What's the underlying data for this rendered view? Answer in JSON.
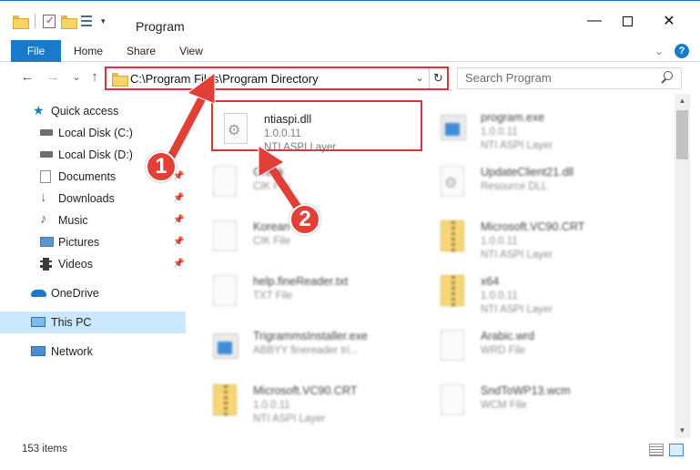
{
  "window": {
    "title": "Program",
    "minimize": "—",
    "close": "✕"
  },
  "ribbon": {
    "tabs": [
      "File",
      "Home",
      "Share",
      "View"
    ],
    "expand": "⌄",
    "help": "?"
  },
  "nav": {
    "back": "←",
    "forward": "→",
    "recent": "⌄",
    "up": "↑"
  },
  "address": {
    "path": "C:\\Program Files\\Program Directory",
    "dropdown": "⌄",
    "refresh": "↻"
  },
  "search": {
    "placeholder": "Search Program"
  },
  "sidebar": {
    "items": [
      {
        "label": "Quick access",
        "icon": "star-icon"
      },
      {
        "label": "Local Disk (C:)",
        "icon": "drive-icon"
      },
      {
        "label": "Local Disk (D:)",
        "icon": "drive-icon"
      },
      {
        "label": "Documents",
        "icon": "documents-icon"
      },
      {
        "label": "Downloads",
        "icon": "download-icon"
      },
      {
        "label": "Music",
        "icon": "music-icon"
      },
      {
        "label": "Pictures",
        "icon": "pictures-icon"
      },
      {
        "label": "Videos",
        "icon": "videos-icon"
      },
      {
        "label": "OneDrive",
        "icon": "cloud-icon"
      },
      {
        "label": "This PC",
        "icon": "computer-icon"
      },
      {
        "label": "Network",
        "icon": "network-icon"
      }
    ],
    "pin": "📌"
  },
  "files": [
    {
      "name": "ntiaspi.dll",
      "version": "1.0.0.11",
      "type": "NTI ASPI Layer",
      "icon": "dll-gear-icon"
    },
    {
      "name": "program.exe",
      "version": "1.0.0.11",
      "type": "NTI ASPI Layer",
      "icon": "exe-icon"
    },
    {
      "name": "Greek",
      "version": "",
      "type": "CIK File",
      "icon": "document-icon"
    },
    {
      "name": "UpdateClient21.dll",
      "version": "",
      "type": "Resource DLL",
      "icon": "dll-gear-icon"
    },
    {
      "name": "Korean",
      "version": "",
      "type": "CIK File",
      "icon": "document-icon"
    },
    {
      "name": "Microsoft.VC90.CRT",
      "version": "1.0.0.11",
      "type": "NTI ASPI Layer",
      "icon": "zip-folder-icon"
    },
    {
      "name": "help.fineReader.txt",
      "version": "",
      "type": "TXT File",
      "icon": "document-icon"
    },
    {
      "name": "x64",
      "version": "1.0.0.11",
      "type": "NTI ASPI Layer",
      "icon": "zip-folder-icon"
    },
    {
      "name": "TrigrammsInstaller.exe",
      "version": "",
      "type": "ABBYY finereader tri...",
      "icon": "exe-icon"
    },
    {
      "name": "Arabic.wrd",
      "version": "",
      "type": "WRD File",
      "icon": "document-icon"
    },
    {
      "name": "Microsoft.VC90.CRT",
      "version": "1.0.0.11",
      "type": "NTI ASPI Layer",
      "icon": "zip-folder-icon"
    },
    {
      "name": "SndToWP13.wcm",
      "version": "",
      "type": "WCM File",
      "icon": "document-icon"
    }
  ],
  "status": {
    "count": "153 items"
  },
  "callouts": [
    "1",
    "2"
  ],
  "colors": {
    "accent": "#1979ca",
    "highlight": "#e03236",
    "selected": "#cce8ff"
  }
}
